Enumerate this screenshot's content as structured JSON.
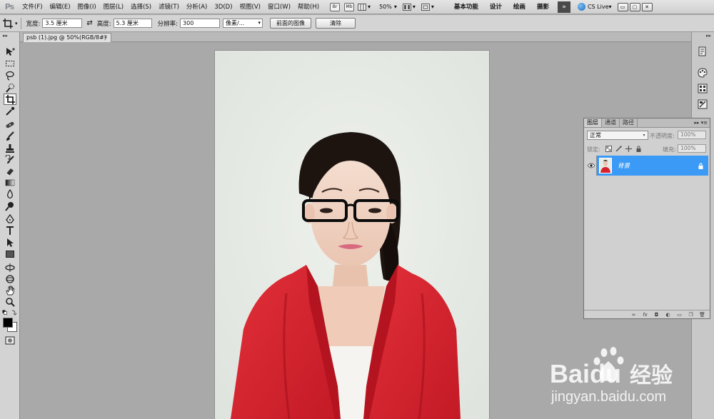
{
  "app": {
    "logo": "Ps"
  },
  "menubar": {
    "items": [
      "文件(F)",
      "编辑(E)",
      "图像(I)",
      "图层(L)",
      "选择(S)",
      "滤镜(T)",
      "分析(A)",
      "3D(D)",
      "视图(V)",
      "窗口(W)",
      "帮助(H)"
    ],
    "br_label": "Br",
    "mb_label": "Mb",
    "zoom": "50%",
    "workspaces": [
      "基本功能",
      "设计",
      "绘画",
      "摄影"
    ],
    "more_label": "»",
    "cs_live": "CS Live▾",
    "window_btns": [
      "▭",
      "▢",
      "✕"
    ]
  },
  "options": {
    "width_label": "宽度:",
    "width_value": "3.5 厘米",
    "swap_label": "⇄",
    "height_label": "高度:",
    "height_value": "5.3 厘米",
    "res_label": "分辨率:",
    "res_value": "300",
    "unit_value": "像素/...",
    "front_image_btn": "前面的图像",
    "clear_btn": "清除"
  },
  "document": {
    "tab_title": "psb (1).jpg @ 50%(RGB/8#)",
    "tab_close": "✕"
  },
  "layers_panel": {
    "tabs": [
      "图层",
      "通道",
      "路径"
    ],
    "menu_glyph": "▸▸ ▾≡",
    "blend_mode": "正常",
    "opacity_label": "不透明度:",
    "opacity_value": "100%",
    "lock_label": "锁定:",
    "fill_label": "填充:",
    "fill_value": "100%",
    "layer_name": "背景"
  },
  "watermark": {
    "brand": "Baidu",
    "jingyan": "经验",
    "url": "jingyan.baidu.com"
  },
  "colors": {
    "layer_selected": "#3a9af6",
    "workspace_bg": "#a9a9a9",
    "shirt_red": "#d8212c"
  }
}
